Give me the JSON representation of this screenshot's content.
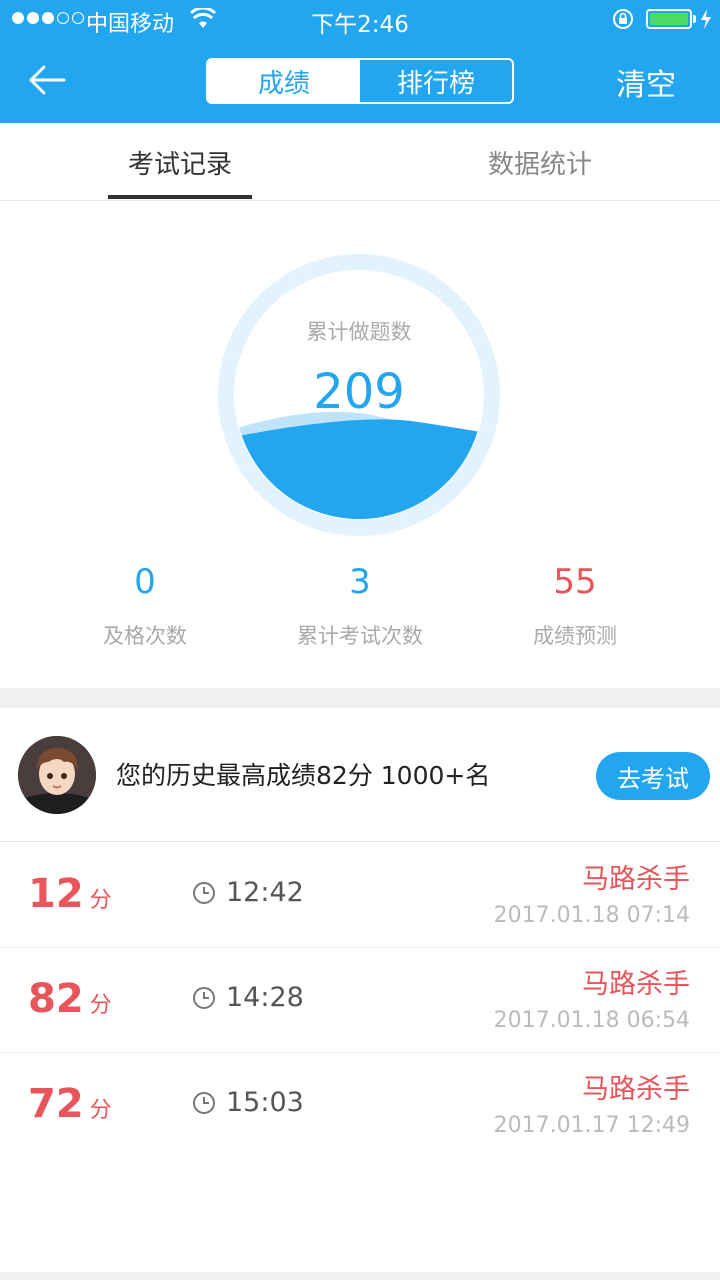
{
  "status_bar": {
    "carrier": "中国移动",
    "time": "下午2:46"
  },
  "nav": {
    "segments": [
      "成绩",
      "排行榜"
    ],
    "active_segment": "成绩",
    "clear_label": "清空",
    "back_icon": "arrow-left-icon"
  },
  "tabs": [
    {
      "label": "考试记录",
      "active": true
    },
    {
      "label": "数据统计",
      "active": false
    }
  ],
  "summary": {
    "gauge_label": "累计做题数",
    "gauge_value": "209",
    "stats": [
      {
        "value": "0",
        "label": "及格次数",
        "color": "#22a6f0"
      },
      {
        "value": "3",
        "label": "累计考试次数",
        "color": "#22a6f0"
      },
      {
        "value": "55",
        "label": "成绩预测",
        "color": "#e8555b"
      }
    ]
  },
  "best": {
    "text": "您的历史最高成绩82分 1000+名",
    "button_label": "去考试"
  },
  "records": [
    {
      "score": "12",
      "unit": "分",
      "duration": "12:42",
      "user": "马路杀手",
      "date": "2017.01.18 07:14"
    },
    {
      "score": "82",
      "unit": "分",
      "duration": "14:28",
      "user": "马路杀手",
      "date": "2017.01.18 06:54"
    },
    {
      "score": "72",
      "unit": "分",
      "duration": "15:03",
      "user": "马路杀手",
      "date": "2017.01.17 12:49"
    }
  ],
  "colors": {
    "primary": "#22a6f0",
    "accent_red": "#e8555b"
  }
}
